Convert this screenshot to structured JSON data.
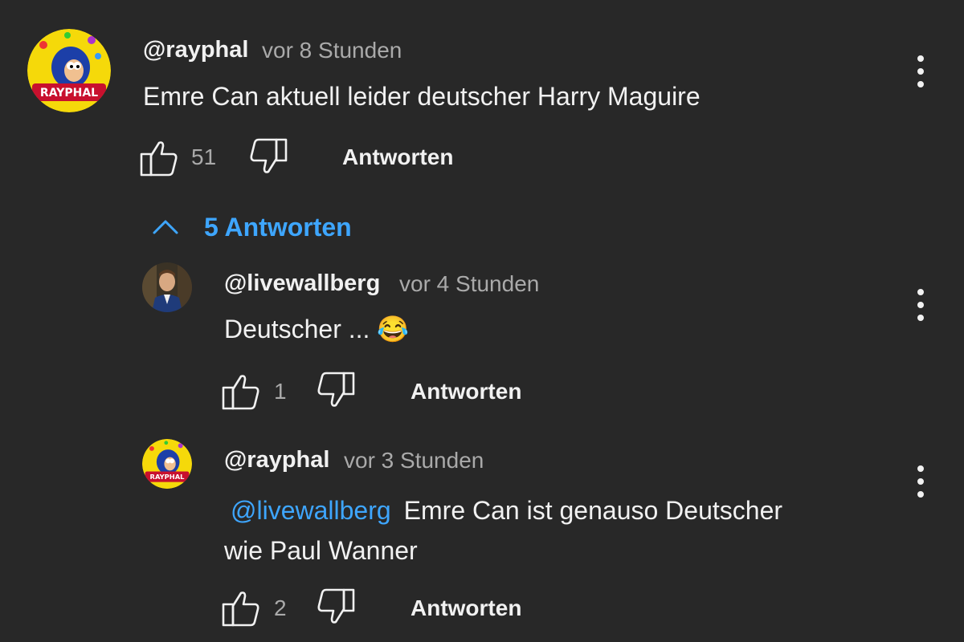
{
  "comment": {
    "handle": "@rayphal",
    "time": "vor 8 Stunden",
    "text": "Emre Can aktuell leider deutscher Harry Maguire",
    "likes": "51",
    "reply_label": "Antworten"
  },
  "replies_toggle": {
    "label": "5 Antworten"
  },
  "replies": [
    {
      "handle": "@livewallberg",
      "time": "vor 4 Stunden",
      "text": "Deutscher ... 😂",
      "likes": "1",
      "reply_label": "Antworten"
    },
    {
      "handle": "@rayphal",
      "time": "vor 3 Stunden",
      "mention": "@livewallberg",
      "text_line1": "Emre Can ist genauso Deutscher",
      "text_line2": "wie Paul Wanner",
      "likes": "2",
      "reply_label": "Antworten"
    }
  ],
  "avatar_label": "RAYPHAL",
  "colors": {
    "background": "#282828",
    "text": "#f1f1f1",
    "secondary": "#aaaaaa",
    "link": "#3ea6ff"
  }
}
